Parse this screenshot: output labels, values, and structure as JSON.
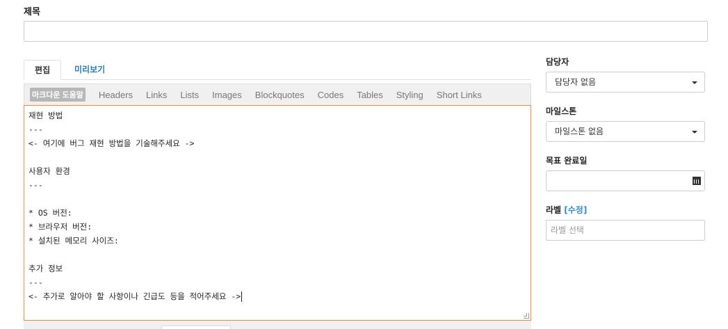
{
  "form": {
    "title_label": "제목",
    "title_value": ""
  },
  "tabs": [
    {
      "label": "편집",
      "active": true
    },
    {
      "label": "미리보기",
      "active": false
    }
  ],
  "toolbar": {
    "help_label": "마크다운 도움말",
    "links": [
      "Headers",
      "Links",
      "Lists",
      "Images",
      "Blockquotes",
      "Codes",
      "Tables",
      "Styling",
      "Short Links"
    ]
  },
  "editor": {
    "lines": [
      "재현 방법",
      "---",
      "<- 여기에 버그 재현 방법을 기술해주세요 ->",
      "",
      "사용자 환경",
      "---",
      "",
      "* OS 버전:",
      "* 브라우저 버전:",
      "* 설치된 메모리 사이즈:",
      "",
      "추가 정보",
      "---",
      "<- 추가로 알아야 할 사항이나 긴급도 등을 적어주세요 ->"
    ]
  },
  "sidebar": {
    "assignee_label": "담당자",
    "assignee_value": "담당자 없음",
    "milestone_label": "마일스톤",
    "milestone_value": "마일스톤 없음",
    "due_label": "목표 완료일",
    "due_value": "",
    "labels_label": "라벨",
    "labels_edit": "[수정]",
    "labels_placeholder": "라벨 선택"
  },
  "icons": {
    "select_caret": "chevron-down-icon",
    "calendar": "calendar-icon",
    "resize": "resize-grip-icon"
  }
}
